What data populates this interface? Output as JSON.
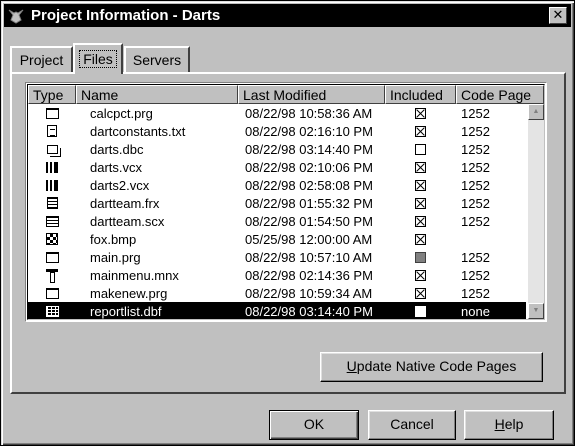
{
  "window": {
    "title": "Project Information - Darts",
    "close_label": "✕"
  },
  "tabs": [
    {
      "label": "Project"
    },
    {
      "label": "Files"
    },
    {
      "label": "Servers"
    }
  ],
  "files_table": {
    "columns": [
      "Type",
      "Name",
      "Last Modified",
      "Included",
      "Code Page"
    ],
    "rows": [
      {
        "icon": "program-icon",
        "name": "calcpct.prg",
        "modified": "08/22/98 10:58:36 AM",
        "included": "checked",
        "code_page": "1252"
      },
      {
        "icon": "text-file-icon",
        "name": "dartconstants.txt",
        "modified": "08/22/98 02:16:10 PM",
        "included": "checked",
        "code_page": "1252"
      },
      {
        "icon": "database-icon",
        "name": "darts.dbc",
        "modified": "08/22/98 03:14:40 PM",
        "included": "unchecked",
        "code_page": "1252"
      },
      {
        "icon": "class-library-icon",
        "name": "darts.vcx",
        "modified": "08/22/98 02:10:06 PM",
        "included": "checked",
        "code_page": "1252"
      },
      {
        "icon": "class-library-icon",
        "name": "darts2.vcx",
        "modified": "08/22/98 02:58:08 PM",
        "included": "checked",
        "code_page": "1252"
      },
      {
        "icon": "report-icon",
        "name": "dartteam.frx",
        "modified": "08/22/98 01:55:32 PM",
        "included": "checked",
        "code_page": "1252"
      },
      {
        "icon": "form-icon",
        "name": "dartteam.scx",
        "modified": "08/22/98 01:54:50 PM",
        "included": "checked",
        "code_page": "1252"
      },
      {
        "icon": "bitmap-icon",
        "name": "fox.bmp",
        "modified": "05/25/98 12:00:00 AM",
        "included": "checked",
        "code_page": ""
      },
      {
        "icon": "program-icon",
        "name": "main.prg",
        "modified": "08/22/98 10:57:10 AM",
        "included": "grayed",
        "code_page": "1252"
      },
      {
        "icon": "menu-icon",
        "name": "mainmenu.mnx",
        "modified": "08/22/98 02:14:36 PM",
        "included": "checked",
        "code_page": "1252"
      },
      {
        "icon": "program-icon",
        "name": "makenew.prg",
        "modified": "08/22/98 10:59:34 AM",
        "included": "checked",
        "code_page": "1252"
      },
      {
        "icon": "table-icon",
        "name": "reportlist.dbf",
        "modified": "08/22/98 03:14:40 PM",
        "included": "unchecked",
        "code_page": "none",
        "selected": true
      }
    ]
  },
  "buttons": {
    "update": {
      "pre": "",
      "mnemonic": "U",
      "post": "pdate Native Code Pages"
    },
    "ok": {
      "pre": "OK",
      "mnemonic": "",
      "post": ""
    },
    "cancel": {
      "pre": "Cancel",
      "mnemonic": "",
      "post": ""
    },
    "help": {
      "pre": "",
      "mnemonic": "H",
      "post": "elp"
    }
  }
}
